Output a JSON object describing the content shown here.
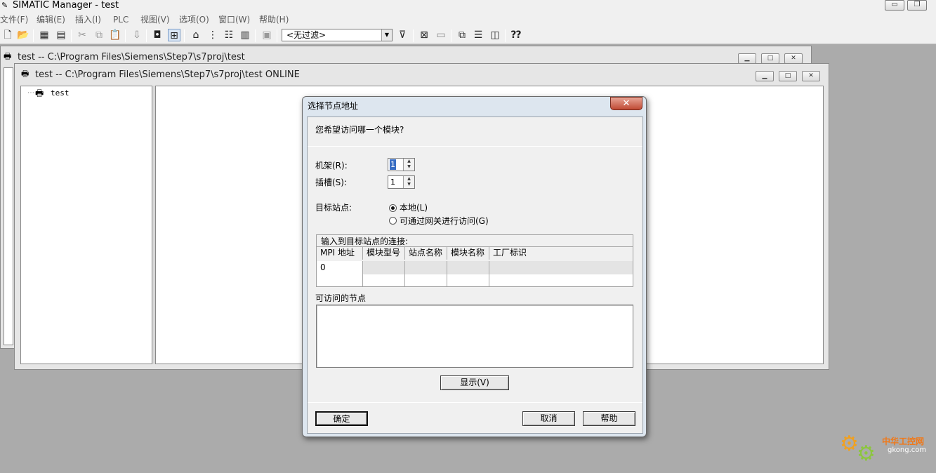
{
  "app": {
    "title": "SIMATIC Manager - test",
    "controls": {
      "minimize": "▭",
      "restore": "❐"
    }
  },
  "menu": [
    "文件(F)",
    "编辑(E)",
    "插入(I)",
    "PLC",
    "视图(V)",
    "选项(O)",
    "窗口(W)",
    "帮助(H)"
  ],
  "toolbar": {
    "filter_value": "<无过滤>"
  },
  "windows": {
    "back": {
      "title": "test -- C:\\Program Files\\Siemens\\Step7\\s7proj\\test"
    },
    "front": {
      "title": "test -- C:\\Program Files\\Siemens\\Step7\\s7proj\\test  ONLINE",
      "tree_root": "test"
    }
  },
  "dialog": {
    "title": "选择节点地址",
    "close": "✕",
    "question": "您希望访问哪一个模块?",
    "rack_label": "机架(R):",
    "rack_value": "1",
    "slot_label": "插槽(S):",
    "slot_value": "1",
    "target_label": "目标站点:",
    "radio_local": "本地(L)",
    "radio_gateway": "可通过网关进行访问(G)",
    "conn_group_label": "输入到目标站点的连接:",
    "columns": [
      "MPI 地址",
      "模块型号",
      "站点名称",
      "模块名称",
      "工厂标识"
    ],
    "rows": [
      [
        "0",
        "",
        "",
        "",
        ""
      ],
      [
        "",
        "",
        "",
        "",
        ""
      ]
    ],
    "accessible_nodes_label": "可访问的节点",
    "show_button": "显示(V)",
    "ok_button": "确定",
    "cancel_button": "取消",
    "help_button": "帮助"
  },
  "watermark": {
    "brand": "中华工控网",
    "domain": "gkong.com"
  }
}
